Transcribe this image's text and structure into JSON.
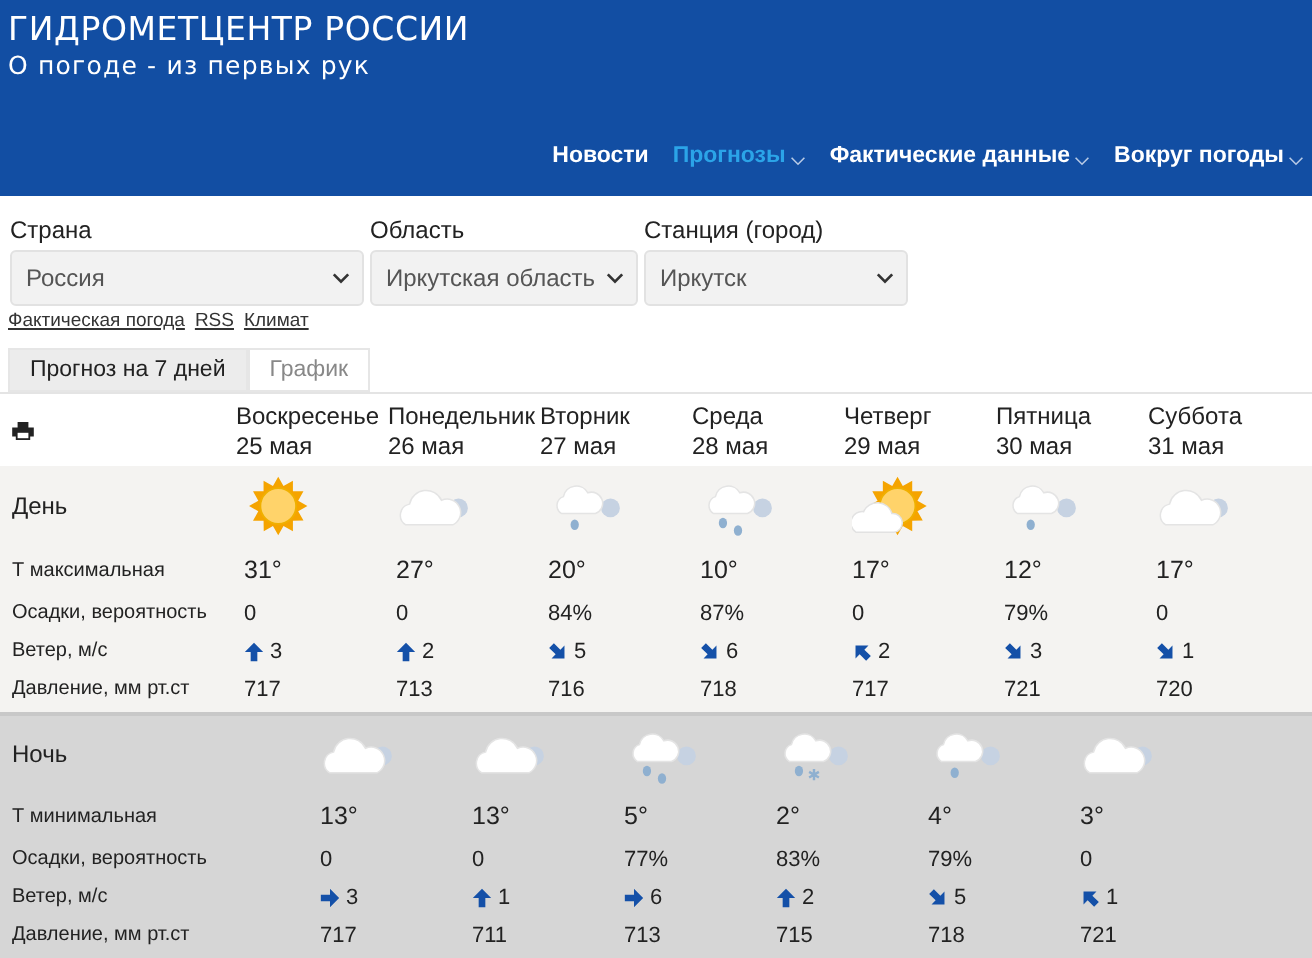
{
  "header": {
    "title": "ГИДРОМЕТЦЕНТР РОССИИ",
    "subtitle": "О погоде - из первых рук"
  },
  "nav": [
    {
      "label": "Новости",
      "selected": false,
      "dropdown": false
    },
    {
      "label": "Прогнозы",
      "selected": true,
      "dropdown": true
    },
    {
      "label": "Фактические данные",
      "selected": false,
      "dropdown": true
    },
    {
      "label": "Вокруг погоды",
      "selected": false,
      "dropdown": true
    }
  ],
  "filters": [
    {
      "label": "Страна",
      "value": "Россия"
    },
    {
      "label": "Область",
      "value": "Иркутская область"
    },
    {
      "label": "Станция (город)",
      "value": "Иркутск"
    }
  ],
  "links": [
    "Фактическая погода",
    "RSS",
    "Климат"
  ],
  "tabs": [
    {
      "label": "Прогноз на 7 дней",
      "selected": true
    },
    {
      "label": "График",
      "selected": false
    }
  ],
  "days": [
    {
      "weekday": "Воскресенье",
      "date": "25 мая"
    },
    {
      "weekday": "Понедельник",
      "date": "26 мая"
    },
    {
      "weekday": "Вторник",
      "date": "27 мая"
    },
    {
      "weekday": "Среда",
      "date": "28 мая"
    },
    {
      "weekday": "Четверг",
      "date": "29 мая"
    },
    {
      "weekday": "Пятница",
      "date": "30 мая"
    },
    {
      "weekday": "Суббота",
      "date": "31 мая"
    }
  ],
  "sections": [
    {
      "title": "День",
      "kind": "day",
      "icons": [
        {
          "kind": "sun"
        },
        {
          "kind": "cloud"
        },
        {
          "kind": "cloud-rain"
        },
        {
          "kind": "cloud-heavy-rain"
        },
        {
          "kind": "sun-cloud"
        },
        {
          "kind": "cloud-rain"
        },
        {
          "kind": "cloud"
        }
      ],
      "rows": [
        {
          "label": "Т максимальная",
          "kind": "temp",
          "values": [
            "31°",
            "27°",
            "20°",
            "10°",
            "17°",
            "12°",
            "17°"
          ]
        },
        {
          "label": "Осадки, вероятность",
          "kind": "text",
          "values": [
            "0",
            "0",
            "84%",
            "87%",
            "0",
            "79%",
            "0"
          ]
        },
        {
          "label": "Ветер, м/с",
          "kind": "wind",
          "values": [
            {
              "kind": "n",
              "speed": "3"
            },
            {
              "kind": "n",
              "speed": "2"
            },
            {
              "kind": "se",
              "speed": "5"
            },
            {
              "kind": "se",
              "speed": "6"
            },
            {
              "kind": "nw",
              "speed": "2"
            },
            {
              "kind": "se",
              "speed": "3"
            },
            {
              "kind": "se",
              "speed": "1"
            }
          ]
        },
        {
          "label": "Давление, мм рт.ст",
          "kind": "text",
          "values": [
            "717",
            "713",
            "716",
            "718",
            "717",
            "721",
            "720"
          ]
        }
      ]
    },
    {
      "title": "Ночь",
      "kind": "night",
      "icons": [
        {
          "kind": "cloud"
        },
        {
          "kind": "cloud"
        },
        {
          "kind": "cloud-heavy-rain"
        },
        {
          "kind": "cloud-sleet"
        },
        {
          "kind": "cloud-rain"
        },
        {
          "kind": "cloud"
        }
      ],
      "rows": [
        {
          "label": "Т минимальная",
          "kind": "temp",
          "values": [
            "13°",
            "13°",
            "5°",
            "2°",
            "4°",
            "3°"
          ]
        },
        {
          "label": "Осадки, вероятность",
          "kind": "text",
          "values": [
            "0",
            "0",
            "77%",
            "83%",
            "79%",
            "0"
          ]
        },
        {
          "label": "Ветер, м/с",
          "kind": "wind",
          "values": [
            {
              "kind": "e",
              "speed": "3"
            },
            {
              "kind": "n",
              "speed": "1"
            },
            {
              "kind": "e",
              "speed": "6"
            },
            {
              "kind": "n",
              "speed": "2"
            },
            {
              "kind": "se",
              "speed": "5"
            },
            {
              "kind": "nw",
              "speed": "1"
            }
          ]
        },
        {
          "label": "Давление, мм рт.ст",
          "kind": "text",
          "values": [
            "717",
            "711",
            "713",
            "715",
            "718",
            "721"
          ]
        }
      ]
    }
  ]
}
